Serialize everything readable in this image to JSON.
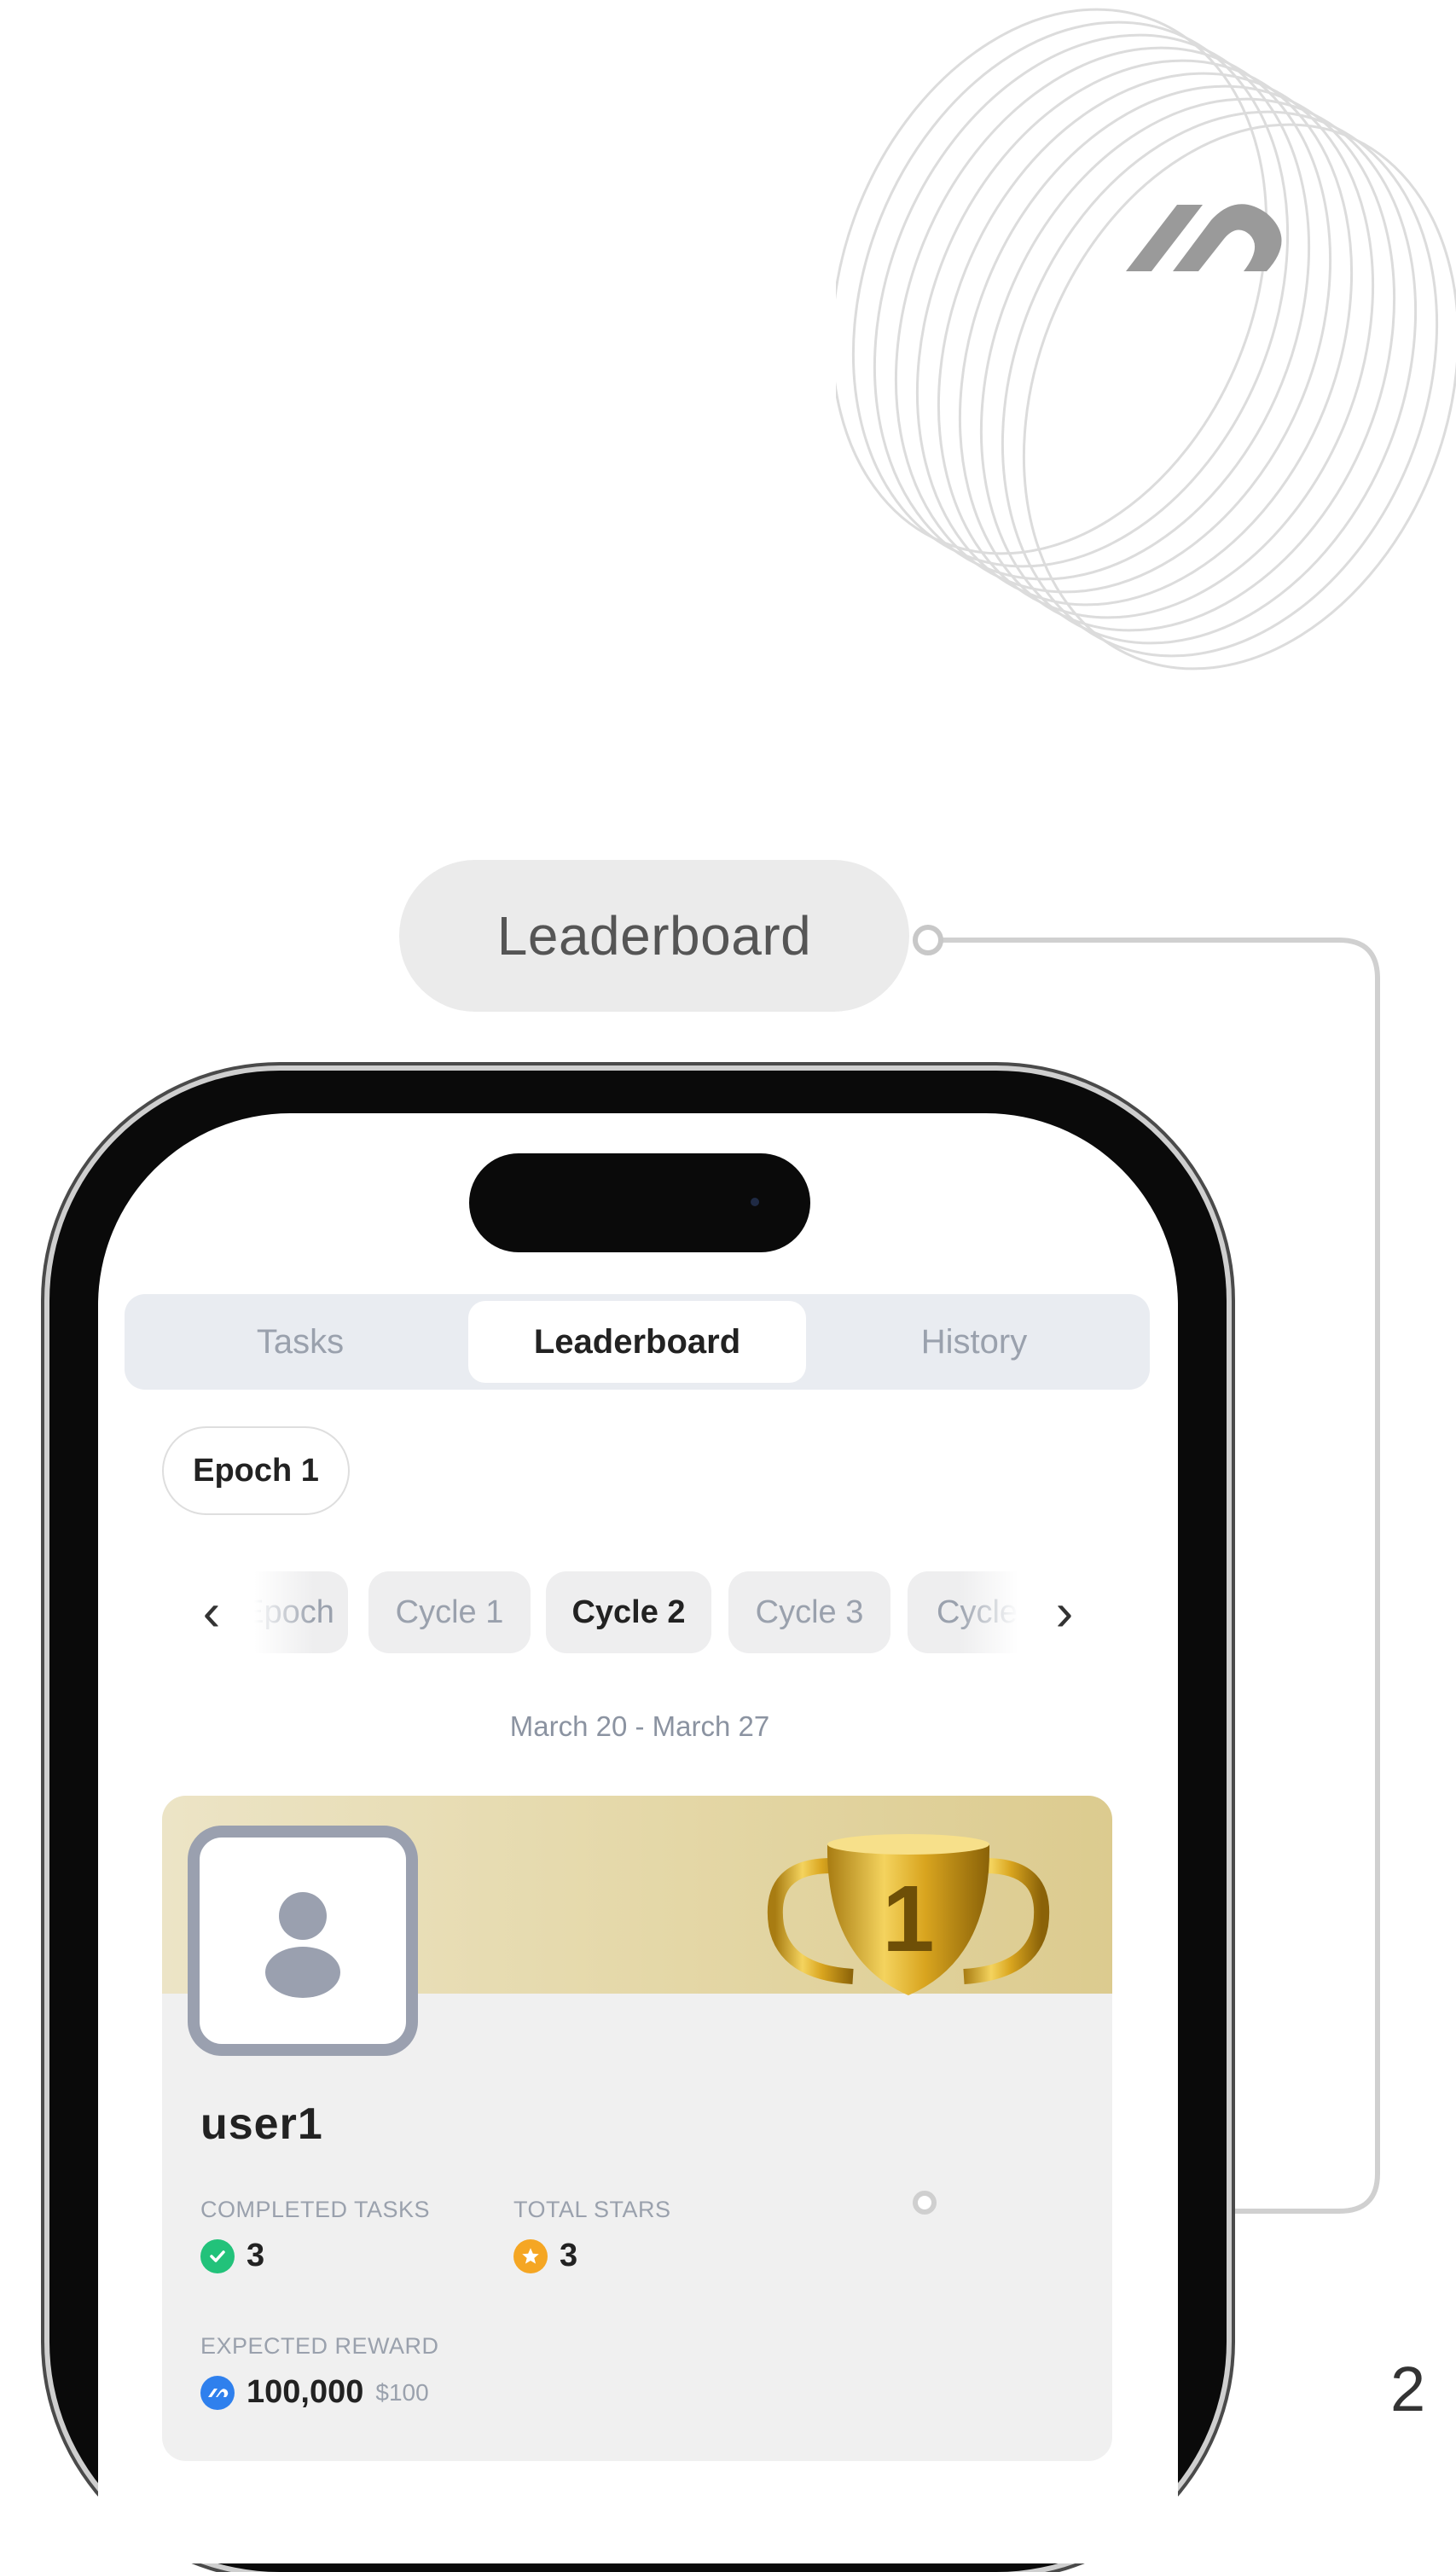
{
  "callout": {
    "label": "Leaderboard"
  },
  "tabs": [
    {
      "label": "Tasks",
      "active": false
    },
    {
      "label": "Leaderboard",
      "active": true
    },
    {
      "label": "History",
      "active": false
    }
  ],
  "epoch_selector": {
    "label": "Epoch 1"
  },
  "cycles": {
    "items": [
      {
        "label": "Epoch",
        "active": false
      },
      {
        "label": "Cycle 1",
        "active": false
      },
      {
        "label": "Cycle 2",
        "active": true
      },
      {
        "label": "Cycle 3",
        "active": false
      },
      {
        "label": "Cycle",
        "active": false
      }
    ],
    "date_range": "March 20 - March 27"
  },
  "user_card": {
    "username": "user1",
    "completed_tasks_label": "COMPLETED TASKS",
    "completed_tasks_value": "3",
    "total_stars_label": "TOTAL STARS",
    "total_stars_value": "3",
    "expected_reward_label": "EXPECTED REWARD",
    "expected_reward_value": "100,000",
    "expected_reward_usd": "$100",
    "rank": "1"
  },
  "page_number": "2",
  "colors": {
    "accent_green": "#22c27a",
    "accent_orange": "#f5a623",
    "accent_blue": "#2f80ed",
    "trophy_gold": "#d4a826"
  },
  "icons": [
    "brand-logo-icon",
    "chevron-left-icon",
    "chevron-right-icon",
    "user-avatar-icon",
    "trophy-icon",
    "check-icon",
    "star-icon",
    "token-icon"
  ]
}
